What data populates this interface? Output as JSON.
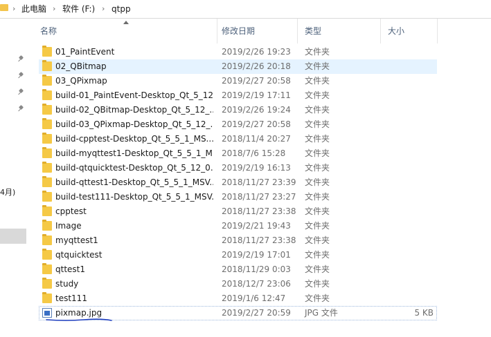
{
  "breadcrumb": [
    "此电脑",
    "软件 (F:)",
    "qtpp"
  ],
  "breadcrumb_sep": "›",
  "nav_partial_text": "4月)",
  "columns": {
    "name": "名称",
    "date": "修改日期",
    "type": "类型",
    "size": "大小"
  },
  "rows": [
    {
      "name": "01_PaintEvent",
      "date": "2019/2/26 19:23",
      "type": "文件夹",
      "size": "",
      "icon": "folder-icon"
    },
    {
      "name": "02_QBitmap",
      "date": "2019/2/26 20:18",
      "type": "文件夹",
      "size": "",
      "icon": "folder-icon",
      "selected": true
    },
    {
      "name": "03_QPixmap",
      "date": "2019/2/27 20:58",
      "type": "文件夹",
      "size": "",
      "icon": "folder-icon"
    },
    {
      "name": "build-01_PaintEvent-Desktop_Qt_5_12...",
      "date": "2019/2/19 17:11",
      "type": "文件夹",
      "size": "",
      "icon": "folder-icon"
    },
    {
      "name": "build-02_QBitmap-Desktop_Qt_5_12_...",
      "date": "2019/2/26 19:24",
      "type": "文件夹",
      "size": "",
      "icon": "folder-icon"
    },
    {
      "name": "build-03_QPixmap-Desktop_Qt_5_12_...",
      "date": "2019/2/27 20:58",
      "type": "文件夹",
      "size": "",
      "icon": "folder-icon"
    },
    {
      "name": "build-cpptest-Desktop_Qt_5_5_1_MS...",
      "date": "2018/11/4 20:27",
      "type": "文件夹",
      "size": "",
      "icon": "folder-icon"
    },
    {
      "name": "build-myqttest1-Desktop_Qt_5_5_1_M...",
      "date": "2018/7/6 15:28",
      "type": "文件夹",
      "size": "",
      "icon": "folder-icon"
    },
    {
      "name": "build-qtquicktest-Desktop_Qt_5_12_0...",
      "date": "2019/2/19 16:13",
      "type": "文件夹",
      "size": "",
      "icon": "folder-icon"
    },
    {
      "name": "build-qttest1-Desktop_Qt_5_5_1_MSV...",
      "date": "2018/11/27 23:39",
      "type": "文件夹",
      "size": "",
      "icon": "folder-icon"
    },
    {
      "name": "build-test111-Desktop_Qt_5_5_1_MSV...",
      "date": "2018/11/27 23:27",
      "type": "文件夹",
      "size": "",
      "icon": "folder-icon"
    },
    {
      "name": "cpptest",
      "date": "2018/11/27 23:38",
      "type": "文件夹",
      "size": "",
      "icon": "folder-icon"
    },
    {
      "name": "Image",
      "date": "2019/2/21 19:43",
      "type": "文件夹",
      "size": "",
      "icon": "folder-icon"
    },
    {
      "name": "myqttest1",
      "date": "2018/11/27 23:38",
      "type": "文件夹",
      "size": "",
      "icon": "folder-icon"
    },
    {
      "name": "qtquicktest",
      "date": "2019/2/19 17:01",
      "type": "文件夹",
      "size": "",
      "icon": "folder-icon"
    },
    {
      "name": "qttest1",
      "date": "2018/11/29 0:03",
      "type": "文件夹",
      "size": "",
      "icon": "folder-icon"
    },
    {
      "name": "study",
      "date": "2018/12/7 23:06",
      "type": "文件夹",
      "size": "",
      "icon": "folder-icon"
    },
    {
      "name": "test111",
      "date": "2019/1/6 12:47",
      "type": "文件夹",
      "size": "",
      "icon": "folder-icon"
    },
    {
      "name": "pixmap.jpg",
      "date": "2019/2/27 20:59",
      "type": "JPG 文件",
      "size": "5 KB",
      "icon": "image-file-icon"
    }
  ],
  "colors": {
    "folder": "#f5c946",
    "selected_row": "#e5f3ff",
    "header_text": "#4c607a",
    "annotation": "#1f3fbf"
  }
}
